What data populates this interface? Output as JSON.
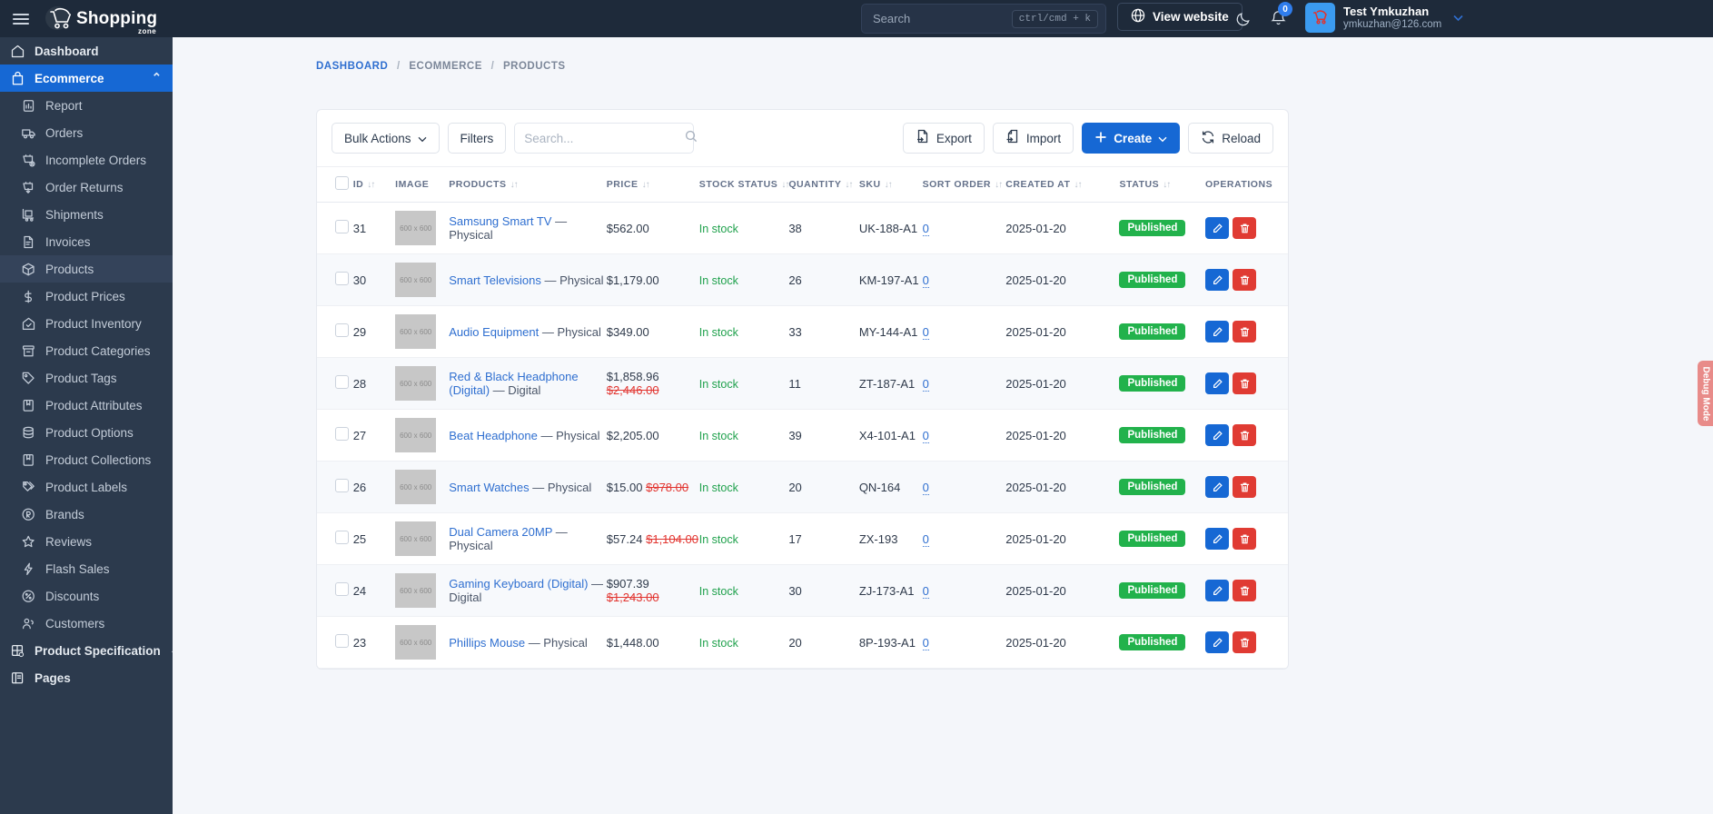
{
  "topbar": {
    "brand_name": "Shopping",
    "brand_sub": "zone",
    "search_placeholder": "Search",
    "search_shortcut": "ctrl/cmd + k",
    "view_website_label": "View website",
    "notification_count": "0",
    "user_name": "Test Ymkuzhan",
    "user_email": "ymkuzhan@126.com"
  },
  "sidebar": {
    "items": [
      {
        "label": "Dashboard",
        "icon": "home-icon",
        "level": "top",
        "state": "normal"
      },
      {
        "label": "Ecommerce",
        "icon": "bag-icon",
        "level": "top",
        "state": "active",
        "chevron": "⌃"
      },
      {
        "label": "Report",
        "icon": "report-icon",
        "level": "sub",
        "state": "normal"
      },
      {
        "label": "Orders",
        "icon": "truck-icon",
        "level": "sub",
        "state": "normal"
      },
      {
        "label": "Incomplete Orders",
        "icon": "cart-x-icon",
        "level": "sub",
        "state": "normal"
      },
      {
        "label": "Order Returns",
        "icon": "cart-down-icon",
        "level": "sub",
        "state": "normal"
      },
      {
        "label": "Shipments",
        "icon": "dolly-icon",
        "level": "sub",
        "state": "normal"
      },
      {
        "label": "Invoices",
        "icon": "invoice-icon",
        "level": "sub",
        "state": "normal"
      },
      {
        "label": "Products",
        "icon": "box-icon",
        "level": "sub",
        "state": "highlight"
      },
      {
        "label": "Product Prices",
        "icon": "dollar-icon",
        "level": "sub",
        "state": "normal"
      },
      {
        "label": "Product Inventory",
        "icon": "inventory-icon",
        "level": "sub",
        "state": "normal"
      },
      {
        "label": "Product Categories",
        "icon": "archive-icon",
        "level": "sub",
        "state": "normal"
      },
      {
        "label": "Product Tags",
        "icon": "tag-icon",
        "level": "sub",
        "state": "normal"
      },
      {
        "label": "Product Attributes",
        "icon": "bookmark-icon",
        "level": "sub",
        "state": "normal"
      },
      {
        "label": "Product Options",
        "icon": "database-icon",
        "level": "sub",
        "state": "normal"
      },
      {
        "label": "Product Collections",
        "icon": "bookmark-icon",
        "level": "sub",
        "state": "normal"
      },
      {
        "label": "Product Labels",
        "icon": "tags-icon",
        "level": "sub",
        "state": "normal"
      },
      {
        "label": "Brands",
        "icon": "registered-icon",
        "level": "sub",
        "state": "normal"
      },
      {
        "label": "Reviews",
        "icon": "star-icon",
        "level": "sub",
        "state": "normal"
      },
      {
        "label": "Flash Sales",
        "icon": "bolt-icon",
        "level": "sub",
        "state": "normal"
      },
      {
        "label": "Discounts",
        "icon": "percent-icon",
        "level": "sub",
        "state": "normal"
      },
      {
        "label": "Customers",
        "icon": "users-icon",
        "level": "sub",
        "state": "normal"
      },
      {
        "label": "Product Specification",
        "icon": "grid-gear-icon",
        "level": "top",
        "state": "normal",
        "chevron": "⌄"
      },
      {
        "label": "Pages",
        "icon": "pages-icon",
        "level": "top",
        "state": "normal"
      }
    ]
  },
  "breadcrumb": {
    "dashboard": "DASHBOARD",
    "ecommerce": "ECOMMERCE",
    "products": "PRODUCTS"
  },
  "toolbar": {
    "bulk_actions_label": "Bulk Actions",
    "filters_label": "Filters",
    "search_placeholder": "Search...",
    "search_value": "",
    "export_label": "Export",
    "import_label": "Import",
    "create_label": "Create",
    "reload_label": "Reload"
  },
  "table": {
    "headers": [
      {
        "label": "",
        "sortable": false,
        "cls": "c-cb"
      },
      {
        "label": "ID",
        "sortable": true,
        "cls": "c-id"
      },
      {
        "label": "IMAGE",
        "sortable": false,
        "cls": "c-img"
      },
      {
        "label": "PRODUCTS",
        "sortable": true,
        "cls": "c-prod"
      },
      {
        "label": "PRICE",
        "sortable": true,
        "cls": "c-price"
      },
      {
        "label": "STOCK STATUS",
        "sortable": true,
        "cls": "c-stock"
      },
      {
        "label": "QUANTITY",
        "sortable": true,
        "cls": "c-qty"
      },
      {
        "label": "SKU",
        "sortable": true,
        "cls": "c-sku"
      },
      {
        "label": "SORT ORDER",
        "sortable": true,
        "cls": "c-sort"
      },
      {
        "label": "CREATED AT",
        "sortable": true,
        "cls": "c-crt"
      },
      {
        "label": "STATUS",
        "sortable": true,
        "cls": "c-sts"
      },
      {
        "label": "OPERATIONS",
        "sortable": false,
        "cls": "c-ops"
      }
    ],
    "image_placeholder": "600 x 600",
    "rows": [
      {
        "id": "31",
        "name": "Samsung Smart TV",
        "type": "— Physical",
        "price": "$562.00",
        "old_price": "",
        "stock": "In stock",
        "qty": "38",
        "sku": "UK-188-A1",
        "sort": "0",
        "created": "2025-01-20",
        "status": "Published"
      },
      {
        "id": "30",
        "name": "Smart Televisions",
        "type": "— Physical",
        "price": "$1,179.00",
        "old_price": "",
        "stock": "In stock",
        "qty": "26",
        "sku": "KM-197-A1",
        "sort": "0",
        "created": "2025-01-20",
        "status": "Published"
      },
      {
        "id": "29",
        "name": "Audio Equipment",
        "type": "— Physical",
        "price": "$349.00",
        "old_price": "",
        "stock": "In stock",
        "qty": "33",
        "sku": "MY-144-A1",
        "sort": "0",
        "created": "2025-01-20",
        "status": "Published"
      },
      {
        "id": "28",
        "name": "Red & Black Headphone (Digital)",
        "type": "— Digital",
        "price": "$1,858.96",
        "old_price": "$2,446.00",
        "stock": "In stock",
        "qty": "11",
        "sku": "ZT-187-A1",
        "sort": "0",
        "created": "2025-01-20",
        "status": "Published"
      },
      {
        "id": "27",
        "name": "Beat Headphone",
        "type": "— Physical",
        "price": "$2,205.00",
        "old_price": "",
        "stock": "In stock",
        "qty": "39",
        "sku": "X4-101-A1",
        "sort": "0",
        "created": "2025-01-20",
        "status": "Published"
      },
      {
        "id": "26",
        "name": "Smart Watches",
        "type": "— Physical",
        "price": "$15.00",
        "old_price": "$978.00",
        "stock": "In stock",
        "qty": "20",
        "sku": "QN-164",
        "sort": "0",
        "created": "2025-01-20",
        "status": "Published"
      },
      {
        "id": "25",
        "name": "Dual Camera 20MP",
        "type": "— Physical",
        "price": "$57.24",
        "old_price": "$1,104.00",
        "stock": "In stock",
        "qty": "17",
        "sku": "ZX-193",
        "sort": "0",
        "created": "2025-01-20",
        "status": "Published"
      },
      {
        "id": "24",
        "name": "Gaming Keyboard (Digital)",
        "type": "— Digital",
        "price": "$907.39",
        "old_price": "$1,243.00",
        "stock": "In stock",
        "qty": "30",
        "sku": "ZJ-173-A1",
        "sort": "0",
        "created": "2025-01-20",
        "status": "Published"
      },
      {
        "id": "23",
        "name": "Phillips Mouse",
        "type": "— Physical",
        "price": "$1,448.00",
        "old_price": "",
        "stock": "In stock",
        "qty": "20",
        "sku": "8P-193-A1",
        "sort": "0",
        "created": "2025-01-20",
        "status": "Published"
      }
    ]
  },
  "debug": {
    "label": "Debug Mode"
  },
  "colors": {
    "accent": "#1668d4",
    "published": "#22b24c",
    "danger": "#e03b33",
    "link": "#2f6fd0",
    "instock": "#1fa14c"
  }
}
